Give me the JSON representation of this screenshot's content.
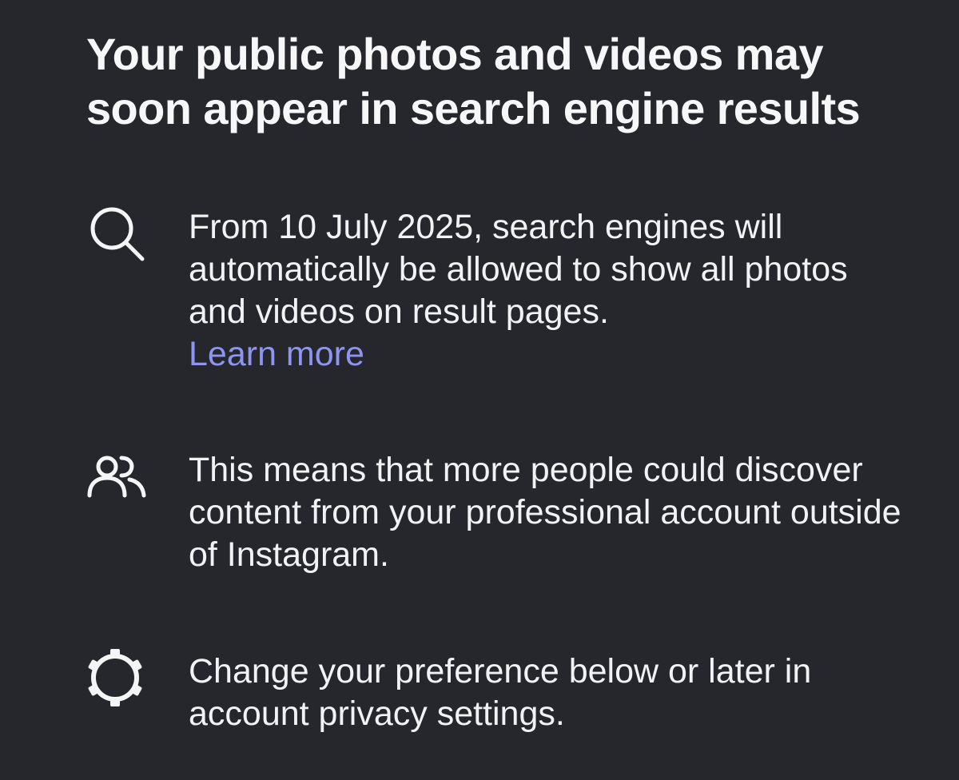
{
  "title": "Your public photos and videos may soon appear in search engine results",
  "colors": {
    "background": "#25272c",
    "text": "#f2f2f4",
    "link": "#8c96f0"
  },
  "items": [
    {
      "icon": "search-icon",
      "text": "From 10 July 2025, search engines will automatically be allowed to show all photos and videos on result pages.",
      "link": "Learn more"
    },
    {
      "icon": "people-icon",
      "text": "This means that more people could discover content from your professional account outside of Instagram."
    },
    {
      "icon": "gear-icon",
      "text": "Change your preference below or later in account privacy settings."
    }
  ]
}
